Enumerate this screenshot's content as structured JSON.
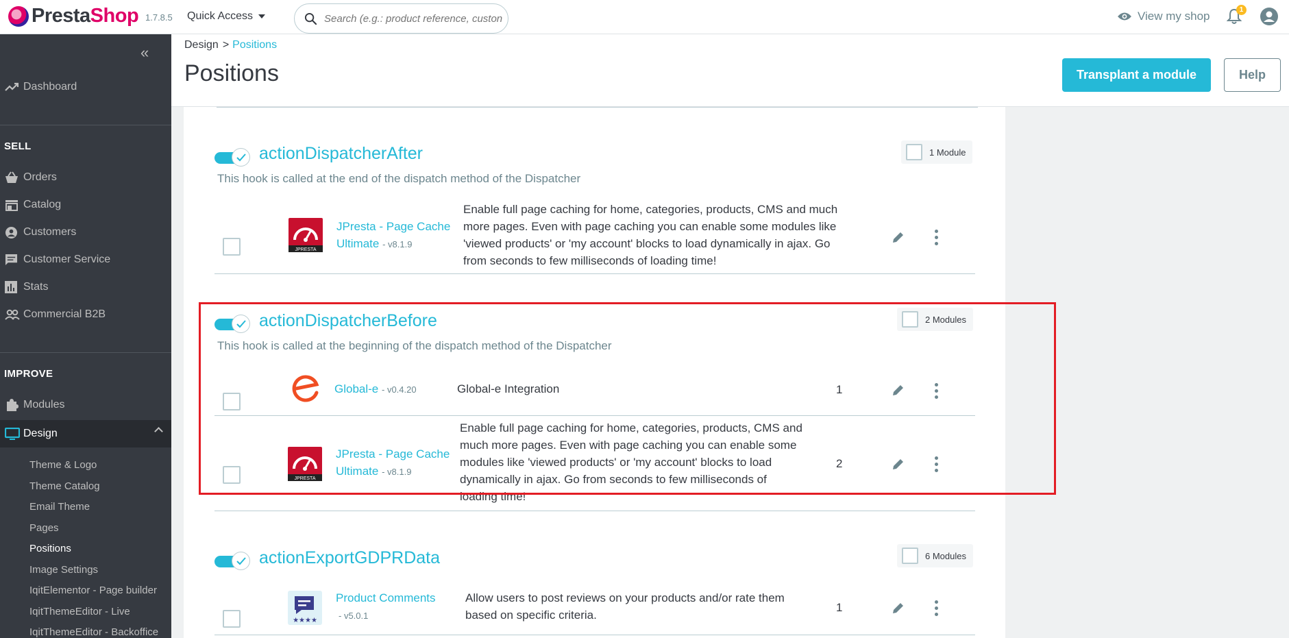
{
  "header": {
    "logo_text_presta": "Presta",
    "logo_text_shop": "Shop",
    "version": "1.7.8.5",
    "quick_access": "Quick Access",
    "search_placeholder": "Search (e.g.: product reference, custon",
    "view_shop": "View my shop",
    "notification_count": "1"
  },
  "sidebar": {
    "dashboard": "Dashboard",
    "sell_section": "SELL",
    "sell_items": [
      "Orders",
      "Catalog",
      "Customers",
      "Customer Service",
      "Stats",
      "Commercial B2B"
    ],
    "improve_section": "IMPROVE",
    "modules": "Modules",
    "design": "Design",
    "design_sub": [
      "Theme & Logo",
      "Theme Catalog",
      "Email Theme",
      "Pages",
      "Positions",
      "Image Settings",
      "IqitElementor - Page builder",
      "IqitThemeEditor - Live",
      "IqitThemeEditor - Backoffice"
    ]
  },
  "toolbar": {
    "breadcrumb_parent": "Design",
    "breadcrumb_sep": ">",
    "breadcrumb_current": "Positions",
    "title": "Positions",
    "transplant_button": "Transplant a module",
    "help_button": "Help"
  },
  "hooks": [
    {
      "name": "actionDispatcherAfter",
      "description": "This hook is called at the end of the dispatch method of the Dispatcher",
      "count": "1 Module",
      "modules": [
        {
          "name_line1": "JPresta - Page Cache",
          "name_line2": "Ultimate",
          "version": "- v8.1.9",
          "logo": "jpresta",
          "desc": [
            "Enable full page caching for home, categories, products, CMS and much",
            "more pages. Even with page caching you can enable some modules like",
            "'viewed products' or 'my account' blocks to load dynamically in ajax. Go",
            "from seconds to few milliseconds of loading time!"
          ],
          "position": ""
        }
      ]
    },
    {
      "name": "actionDispatcherBefore",
      "description": "This hook is called at the beginning of the dispatch method of the Dispatcher",
      "count": "2 Modules",
      "modules": [
        {
          "name_line1": "Global-e",
          "name_line2": "",
          "version": "- v0.4.20",
          "logo": "globale",
          "desc": [
            "Global-e Integration"
          ],
          "position": "1"
        },
        {
          "name_line1": "JPresta - Page Cache",
          "name_line2": "Ultimate",
          "version": "- v8.1.9",
          "logo": "jpresta",
          "desc": [
            "Enable full page caching for home, categories, products, CMS and",
            "much more pages. Even with page caching you can enable some",
            "modules like 'viewed products' or 'my account' blocks to load",
            "dynamically in ajax. Go from seconds to few milliseconds of",
            "loading time!"
          ],
          "position": "2"
        }
      ]
    },
    {
      "name": "actionExportGDPRData",
      "description": "",
      "count": "6 Modules",
      "modules": [
        {
          "name_line1": "Product Comments",
          "name_line2": "",
          "version": "- v5.0.1",
          "logo": "productcomments",
          "desc": [
            "Allow users to post reviews on your products and/or rate them",
            "based on specific criteria."
          ],
          "position": "1"
        }
      ]
    }
  ],
  "jpresta_logo_label": "JPRESTA",
  "colors": {
    "accent": "#25b9d7",
    "sidebar": "#363a41",
    "highlight": "#e31d25",
    "brand": "#df0067"
  }
}
